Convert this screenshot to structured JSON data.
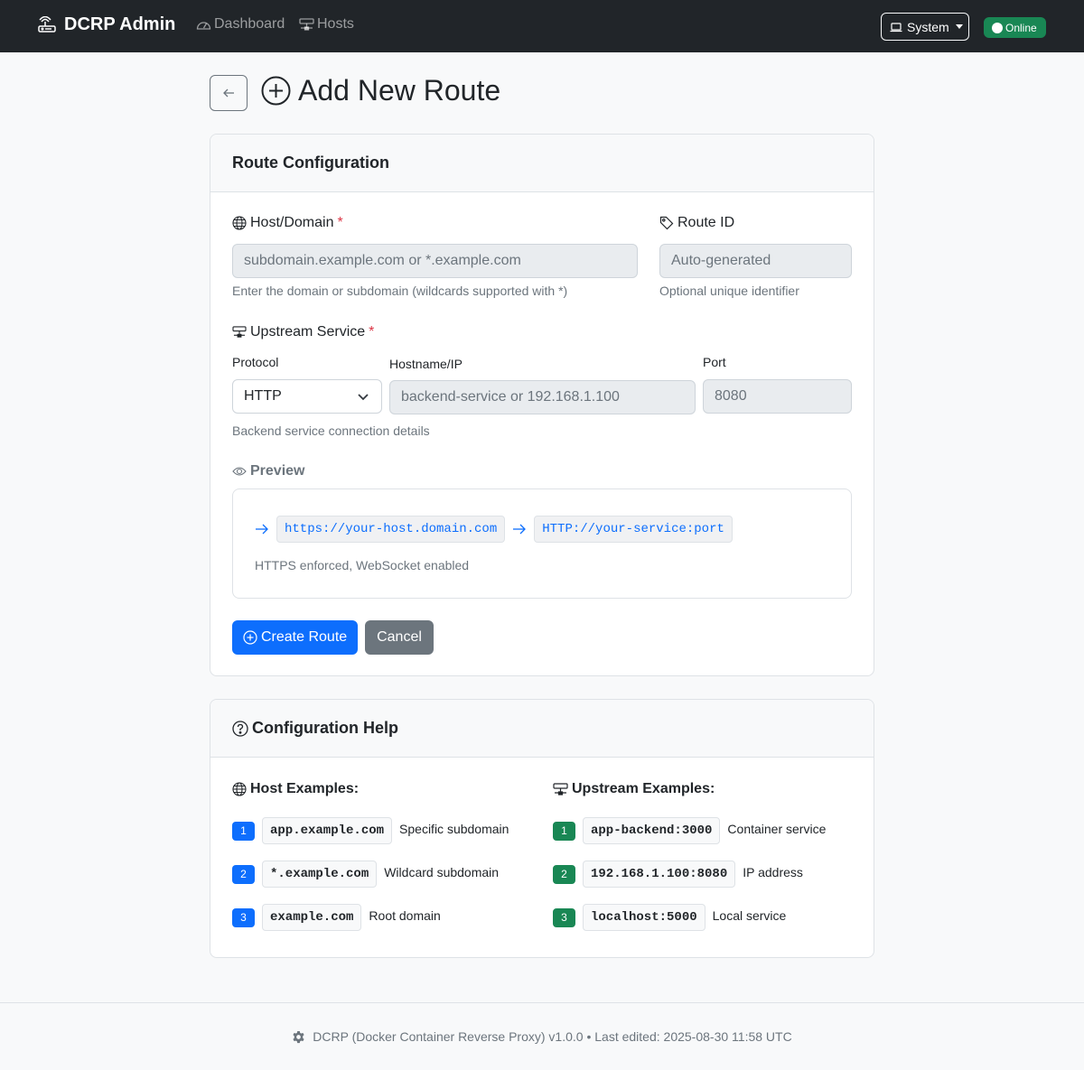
{
  "navbar": {
    "brand": "DCRP Admin",
    "links": [
      {
        "label": "Dashboard",
        "icon": "speedometer-icon"
      },
      {
        "label": "Hosts",
        "icon": "hdd-network-icon"
      }
    ],
    "theme_label": "System",
    "status_label": "Online",
    "status_color": "#198754"
  },
  "page": {
    "title": "Add New Route"
  },
  "route_config": {
    "header": "Route Configuration",
    "host": {
      "label": "Host/Domain",
      "required_mark": "*",
      "placeholder": "subdomain.example.com or *.example.com",
      "help": "Enter the domain or subdomain (wildcards supported with *)"
    },
    "route_id": {
      "label": "Route ID",
      "placeholder": "Auto-generated",
      "help": "Optional unique identifier"
    },
    "upstream": {
      "label": "Upstream Service",
      "required_mark": "*",
      "protocol_label": "Protocol",
      "protocol_value": "HTTP",
      "hostname_label": "Hostname/IP",
      "hostname_placeholder": "backend-service or 192.168.1.100",
      "port_label": "Port",
      "port_placeholder": "8080",
      "help": "Backend service connection details"
    },
    "preview": {
      "label": "Preview",
      "source": "https://your-host.domain.com",
      "target": "HTTP://your-service:port",
      "note": "HTTPS enforced, WebSocket enabled"
    },
    "create_label": "Create Route",
    "cancel_label": "Cancel"
  },
  "config_help": {
    "header": "Configuration Help",
    "host_title": "Host Examples:",
    "host_examples": [
      {
        "num": "1",
        "code": "app.example.com",
        "desc": "Specific subdomain"
      },
      {
        "num": "2",
        "code": "*.example.com",
        "desc": "Wildcard subdomain"
      },
      {
        "num": "3",
        "code": "example.com",
        "desc": "Root domain"
      }
    ],
    "upstream_title": "Upstream Examples:",
    "upstream_examples": [
      {
        "num": "1",
        "code": "app-backend:3000",
        "desc": "Container service"
      },
      {
        "num": "2",
        "code": "192.168.1.100:8080",
        "desc": "IP address"
      },
      {
        "num": "3",
        "code": "localhost:5000",
        "desc": "Local service"
      }
    ]
  },
  "footer": {
    "text": "DCRP (Docker Container Reverse Proxy) v1.0.0 • Last edited: 2025-08-30 11:58 UTC"
  }
}
